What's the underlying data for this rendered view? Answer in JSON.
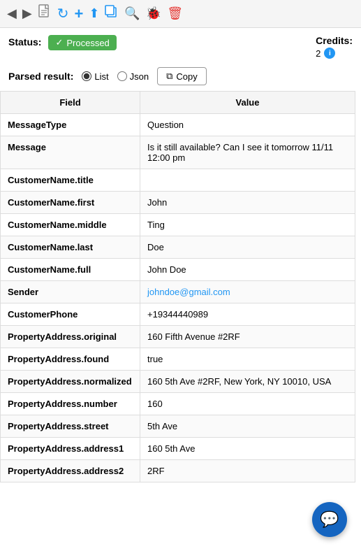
{
  "toolbar": {
    "back_icon": "◀",
    "forward_icon": "▶",
    "doc_icon": "📄",
    "refresh_icon": "↻",
    "add_icon": "+",
    "upload_icon": "▲",
    "copy_icon": "⧉",
    "search_icon": "🔍",
    "bug_icon": "🐞",
    "delete_icon": "🗑"
  },
  "status": {
    "label": "Status:",
    "badge_text": "Processed",
    "check_mark": "✓"
  },
  "credits": {
    "label": "Credits:",
    "value": "2"
  },
  "parsed_result": {
    "label": "Parsed result:",
    "list_option": "List",
    "json_option": "Json",
    "copy_label": "Copy"
  },
  "table": {
    "headers": [
      "Field",
      "Value"
    ],
    "rows": [
      {
        "field": "MessageType",
        "value": "Question",
        "is_email": false
      },
      {
        "field": "Message",
        "value": "Is it still available? Can I see it tomorrow 11/11 12:00 pm",
        "is_email": false
      },
      {
        "field": "CustomerName.title",
        "value": "",
        "is_email": false
      },
      {
        "field": "CustomerName.first",
        "value": "John",
        "is_email": false
      },
      {
        "field": "CustomerName.middle",
        "value": "Ting",
        "is_email": false
      },
      {
        "field": "CustomerName.last",
        "value": "Doe",
        "is_email": false
      },
      {
        "field": "CustomerName.full",
        "value": "John Doe",
        "is_email": false
      },
      {
        "field": "Sender",
        "value": "johndoe@gmail.com",
        "is_email": true
      },
      {
        "field": "CustomerPhone",
        "value": "+19344440989",
        "is_email": false
      },
      {
        "field": "PropertyAddress.original",
        "value": "160 Fifth Avenue #2RF",
        "is_email": false
      },
      {
        "field": "PropertyAddress.found",
        "value": "true",
        "is_email": false
      },
      {
        "field": "PropertyAddress.normalized",
        "value": "160 5th Ave #2RF, New York, NY 10010, USA",
        "is_email": false
      },
      {
        "field": "PropertyAddress.number",
        "value": "160",
        "is_email": false
      },
      {
        "field": "PropertyAddress.street",
        "value": "5th Ave",
        "is_email": false
      },
      {
        "field": "PropertyAddress.address1",
        "value": "160 5th Ave",
        "is_email": false
      },
      {
        "field": "PropertyAddress.address2",
        "value": "2RF",
        "is_email": false
      }
    ]
  },
  "fab": {
    "icon": "💬"
  }
}
